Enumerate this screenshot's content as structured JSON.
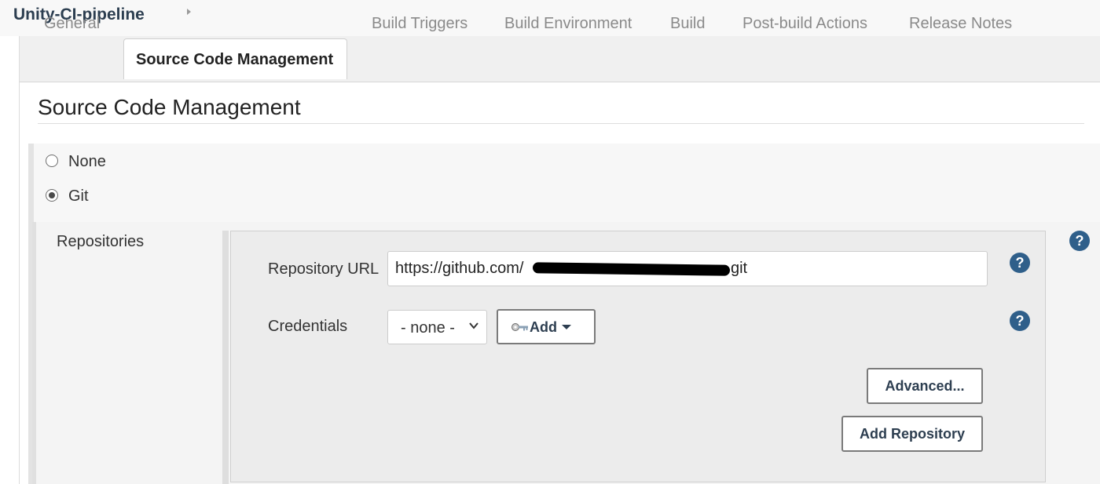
{
  "breadcrumb": {
    "job_name": "Unity-CI-pipeline"
  },
  "tabs": [
    {
      "label": "General",
      "active": false
    },
    {
      "label": "Source Code Management",
      "active": true
    },
    {
      "label": "Build Triggers",
      "active": false
    },
    {
      "label": "Build Environment",
      "active": false
    },
    {
      "label": "Build",
      "active": false
    },
    {
      "label": "Post-build Actions",
      "active": false
    },
    {
      "label": "Release Notes",
      "active": false
    }
  ],
  "section": {
    "title": "Source Code Management"
  },
  "scm_options": [
    {
      "label": "None",
      "selected": false
    },
    {
      "label": "Git",
      "selected": true
    }
  ],
  "repositories": {
    "label": "Repositories",
    "url_label": "Repository URL",
    "url_prefix": "https://github.com/",
    "url_suffix": ".git",
    "url_redacted": true,
    "credentials_label": "Credentials",
    "credentials_value": "- none -",
    "add_button": "Add",
    "advanced_button": "Advanced...",
    "add_repository_button": "Add Repository"
  },
  "help_symbol": "?",
  "icons": {
    "breadcrumb_arrow": "chevron-right-icon",
    "credentials_dropdown": "chevron-down-icon",
    "add_credentials": "key-icon",
    "add_caret": "caret-down-icon",
    "help": "help-icon"
  },
  "colors": {
    "help_icon": "#2f5f8a",
    "button_text": "#2d3e50",
    "active_tab_text": "#222222",
    "inactive_tab_text": "#8a8a8a"
  }
}
